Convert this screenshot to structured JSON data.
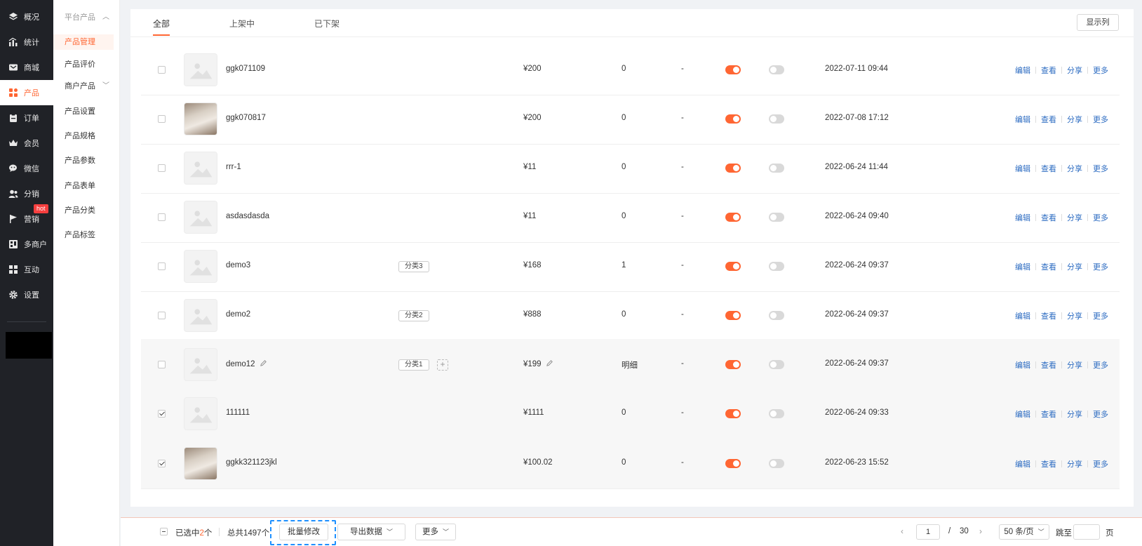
{
  "nav": {
    "items": [
      {
        "label": "概况",
        "icon": "layers-icon"
      },
      {
        "label": "统计",
        "icon": "chart-icon"
      },
      {
        "label": "商城",
        "icon": "mail-icon"
      },
      {
        "label": "产品",
        "icon": "grid-icon"
      },
      {
        "label": "订单",
        "icon": "clipboard-icon"
      },
      {
        "label": "会员",
        "icon": "crown-icon"
      },
      {
        "label": "微信",
        "icon": "wechat-icon"
      },
      {
        "label": "分销",
        "icon": "users-icon"
      },
      {
        "label": "营销",
        "icon": "flag-icon"
      },
      {
        "label": "多商户",
        "icon": "store-icon"
      },
      {
        "label": "互动",
        "icon": "apps-icon"
      },
      {
        "label": "设置",
        "icon": "gear-icon"
      }
    ],
    "hot_badge": "hot"
  },
  "subnav": {
    "items": [
      {
        "label": "平台产品"
      },
      {
        "label": "产品管理"
      },
      {
        "label": "产品评价"
      },
      {
        "label": "商户产品"
      },
      {
        "label": "产品设置"
      },
      {
        "label": "产品规格"
      },
      {
        "label": "产品参数"
      },
      {
        "label": "产品表单"
      },
      {
        "label": "产品分类"
      },
      {
        "label": "产品标签"
      }
    ]
  },
  "tabs": [
    {
      "label": "全部"
    },
    {
      "label": "上架中"
    },
    {
      "label": "已下架"
    }
  ],
  "show_columns_label": "显示列",
  "actions": {
    "edit": "编辑",
    "view": "查看",
    "share": "分享",
    "more": "更多"
  },
  "add_tag_symbol": "+",
  "rows": [
    {
      "name": "ggk071109",
      "tag": "",
      "price": "¥200",
      "stock": "0",
      "col": "-",
      "date": "2022-07-11 09:44",
      "checked": false,
      "photo": false
    },
    {
      "name": "ggk070817",
      "tag": "",
      "price": "¥200",
      "stock": "0",
      "col": "-",
      "date": "2022-07-08 17:12",
      "checked": false,
      "photo": true
    },
    {
      "name": "rrr-1",
      "tag": "",
      "price": "¥11",
      "stock": "0",
      "col": "-",
      "date": "2022-06-24 11:44",
      "checked": false,
      "photo": false
    },
    {
      "name": "asdasdasda",
      "tag": "",
      "price": "¥11",
      "stock": "0",
      "col": "-",
      "date": "2022-06-24 09:40",
      "checked": false,
      "photo": false
    },
    {
      "name": "demo3",
      "tag": "分类3",
      "price": "¥168",
      "stock": "1",
      "col": "-",
      "date": "2022-06-24 09:37",
      "checked": false,
      "photo": false
    },
    {
      "name": "demo2",
      "tag": "分类2",
      "price": "¥888",
      "stock": "0",
      "col": "-",
      "date": "2022-06-24 09:37",
      "checked": false,
      "photo": false
    },
    {
      "name": "demo12",
      "tag": "分类1",
      "price": "¥199",
      "stock": "明细",
      "col": "-",
      "date": "2022-06-24 09:37",
      "checked": false,
      "photo": false
    },
    {
      "name": "111111",
      "tag": "",
      "price": "¥1111",
      "stock": "0",
      "col": "-",
      "date": "2022-06-24 09:33",
      "checked": true,
      "photo": false
    },
    {
      "name": "ggkk321123jkl",
      "tag": "",
      "price": "¥100.02",
      "stock": "0",
      "col": "-",
      "date": "2022-06-23 15:52",
      "checked": true,
      "photo": true
    }
  ],
  "footer": {
    "selected_prefix": "已选中",
    "selected_count": "2",
    "selected_suffix": "个",
    "total_text": "总共1497个",
    "batch_edit": "批量修改",
    "export": "导出数据",
    "more": "更多",
    "page_prev": "‹",
    "page_current": "1",
    "page_sep": "/",
    "page_total": "30",
    "page_next": "›",
    "page_size": "50 条/页",
    "jump_label": "跳至",
    "jump_value": "",
    "page_unit": "页"
  },
  "colors": {
    "accent": "#ff6633",
    "link": "#2d6cc2",
    "nav_bg": "#202227"
  }
}
